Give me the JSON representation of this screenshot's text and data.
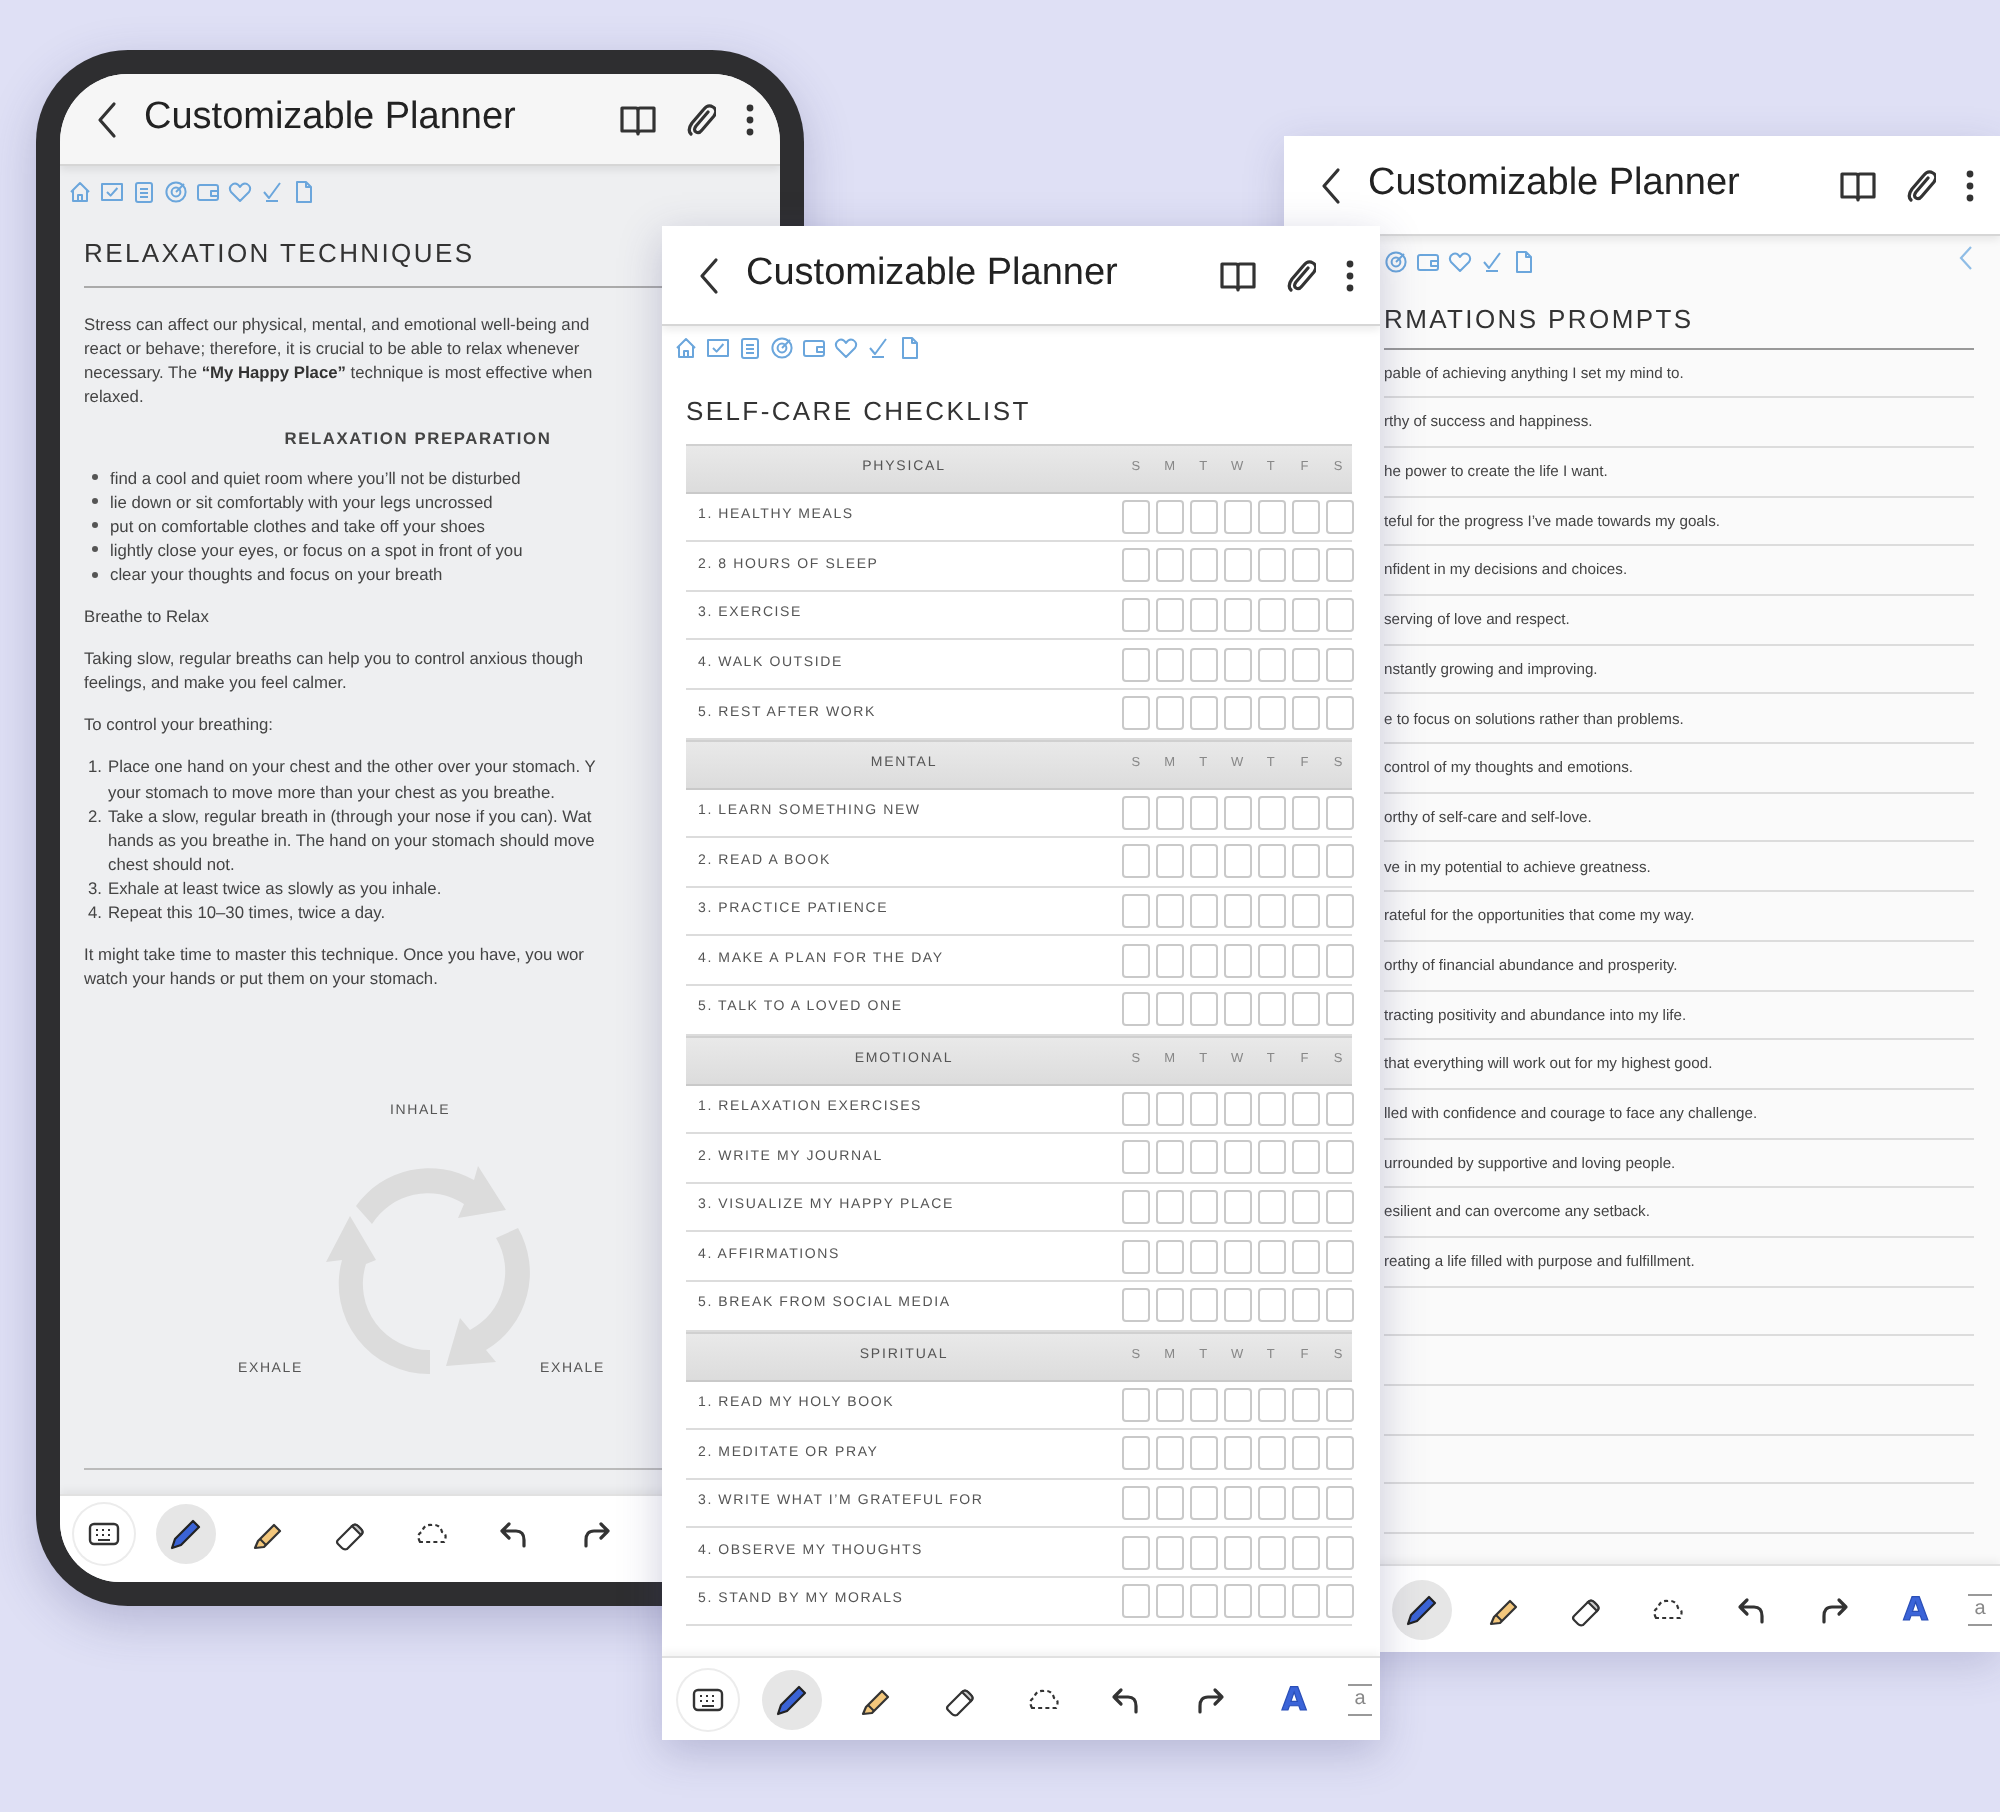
{
  "screens": [
    {
      "kind": "relaxation",
      "title": "Customizable Planner",
      "heading": "RELAXATION TECHNIQUES",
      "intro": [
        "Stress can affect our physical, mental, and emotional well-being and",
        "react or behave; therefore, it is crucial to be able to relax whenever",
        "necessary. The **“My Happy Place”** technique is most effective when",
        "relaxed."
      ],
      "subheading": "RELAXATION PREPARATION",
      "bullets": [
        "find a cool and quiet room where you’ll not be disturbed",
        "lie down or sit comfortably with your legs uncrossed",
        "put on comfortable clothes and take off your shoes",
        "lightly close your eyes, or focus on a spot in front of you",
        "clear your thoughts and focus on your breath"
      ],
      "breathe_title": "Breathe to Relax",
      "breathe_text": [
        "Taking slow, regular breaths can help you to control anxious though",
        "feelings, and make you feel calmer."
      ],
      "control_title": "To control your breathing:",
      "steps": [
        {
          "number": "1.",
          "lines": [
            "Place one hand on your chest and the other over your stomach. Y",
            "your stomach to move more than your chest as you breathe."
          ]
        },
        {
          "number": "2.",
          "lines": [
            "Take a slow, regular breath in (through your nose if you can). Wat",
            "hands as you breathe in. The hand on your stomach should move",
            "chest should not."
          ]
        },
        {
          "number": "3.",
          "lines": [
            "Exhale at least twice as slowly as you inhale."
          ]
        },
        {
          "number": "4.",
          "lines": [
            "Repeat this 10–30 times, twice a day."
          ]
        }
      ],
      "closing": [
        "It might take time to master this technique. Once you have, you wor",
        "watch your hands or put them on your stomach."
      ],
      "diagram": {
        "top_label": "INHALE",
        "left_label": "EXHALE",
        "right_label": "EXHALE"
      },
      "toolbar": [
        {
          "kind": "keyboard",
          "selected": false
        },
        {
          "kind": "pen",
          "selected": true
        },
        {
          "kind": "highlighter",
          "selected": false
        },
        {
          "kind": "eraser",
          "selected": false
        },
        {
          "kind": "lasso",
          "selected": false
        },
        {
          "kind": "undo",
          "selected": false
        },
        {
          "kind": "redo",
          "selected": false
        }
      ]
    },
    {
      "kind": "checklist",
      "title": "Customizable Planner",
      "heading": "SELF-CARE CHECKLIST",
      "sections": [
        {
          "name": "PHYSICAL",
          "days": [
            "S",
            "M",
            "T",
            "W",
            "T",
            "F",
            "S"
          ],
          "rows": [
            {
              "label": "1. HEALTHY MEALS",
              "checks": [
                false,
                false,
                false,
                false,
                false,
                false,
                false
              ]
            },
            {
              "label": "2. 8 HOURS OF SLEEP",
              "checks": [
                false,
                false,
                false,
                false,
                false,
                false,
                false
              ]
            },
            {
              "label": "3. EXERCISE",
              "checks": [
                false,
                false,
                false,
                false,
                false,
                false,
                false
              ]
            },
            {
              "label": "4. WALK OUTSIDE",
              "checks": [
                false,
                false,
                false,
                false,
                false,
                false,
                false
              ]
            },
            {
              "label": "5. REST AFTER WORK",
              "checks": [
                false,
                false,
                false,
                false,
                false,
                false,
                false
              ]
            }
          ]
        },
        {
          "name": "MENTAL",
          "days": [
            "S",
            "M",
            "T",
            "W",
            "T",
            "F",
            "S"
          ],
          "rows": [
            {
              "label": "1. LEARN SOMETHING NEW",
              "checks": [
                false,
                false,
                false,
                false,
                false,
                false,
                false
              ]
            },
            {
              "label": "2. READ A BOOK",
              "checks": [
                false,
                false,
                false,
                false,
                false,
                false,
                false
              ]
            },
            {
              "label": "3. PRACTICE PATIENCE",
              "checks": [
                false,
                false,
                false,
                false,
                false,
                false,
                false
              ]
            },
            {
              "label": "4. MAKE A PLAN FOR THE DAY",
              "checks": [
                false,
                false,
                false,
                false,
                false,
                false,
                false
              ]
            },
            {
              "label": "5. TALK TO A LOVED ONE",
              "checks": [
                false,
                false,
                false,
                false,
                false,
                false,
                false
              ]
            }
          ]
        },
        {
          "name": "EMOTIONAL",
          "days": [
            "S",
            "M",
            "T",
            "W",
            "T",
            "F",
            "S"
          ],
          "rows": [
            {
              "label": "1. RELAXATION EXERCISES",
              "checks": [
                false,
                false,
                false,
                false,
                false,
                false,
                false
              ]
            },
            {
              "label": "2. WRITE MY JOURNAL",
              "checks": [
                false,
                false,
                false,
                false,
                false,
                false,
                false
              ]
            },
            {
              "label": "3. VISUALIZE MY HAPPY PLACE",
              "checks": [
                false,
                false,
                false,
                false,
                false,
                false,
                false
              ]
            },
            {
              "label": "4. AFFIRMATIONS",
              "checks": [
                false,
                false,
                false,
                false,
                false,
                false,
                false
              ]
            },
            {
              "label": "5. BREAK FROM SOCIAL MEDIA",
              "checks": [
                false,
                false,
                false,
                false,
                false,
                false,
                false
              ]
            }
          ]
        },
        {
          "name": "SPIRITUAL",
          "days": [
            "S",
            "M",
            "T",
            "W",
            "T",
            "F",
            "S"
          ],
          "rows": [
            {
              "label": "1. READ MY HOLY BOOK",
              "checks": [
                false,
                false,
                false,
                false,
                false,
                false,
                false
              ]
            },
            {
              "label": "2. MEDITATE OR PRAY",
              "checks": [
                false,
                false,
                false,
                false,
                false,
                false,
                false
              ]
            },
            {
              "label": "3. WRITE WHAT I’M GRATEFUL FOR",
              "checks": [
                false,
                false,
                false,
                false,
                false,
                false,
                false
              ]
            },
            {
              "label": "4. OBSERVE MY THOUGHTS",
              "checks": [
                false,
                false,
                false,
                false,
                false,
                false,
                false
              ]
            },
            {
              "label": "5. STAND BY MY MORALS",
              "checks": [
                false,
                false,
                false,
                false,
                false,
                false,
                false
              ]
            }
          ]
        }
      ],
      "toolbar": [
        {
          "kind": "keyboard",
          "selected": false
        },
        {
          "kind": "pen",
          "selected": true
        },
        {
          "kind": "highlighter",
          "selected": false
        },
        {
          "kind": "eraser",
          "selected": false
        },
        {
          "kind": "lasso",
          "selected": false
        },
        {
          "kind": "undo",
          "selected": false
        },
        {
          "kind": "redo",
          "selected": false
        },
        {
          "kind": "text",
          "label": "A",
          "selected": false
        },
        {
          "kind": "textbox",
          "label": "a",
          "selected": false
        }
      ]
    },
    {
      "kind": "affirmations",
      "title": "Customizable Planner",
      "heading": "RMATIONS PROMPTS",
      "prompts": [
        "pable of achieving anything I set my mind to.",
        "rthy of success and happiness.",
        "he power to create the life I want.",
        "teful for the progress I’ve made towards my goals.",
        "nfident in my decisions and choices.",
        "serving of love and respect.",
        "nstantly growing and improving.",
        "e to focus on solutions rather than problems.",
        "control of my thoughts and emotions.",
        "orthy of self-care and self-love.",
        "ve in my potential to achieve greatness.",
        "rateful for the opportunities that come my way.",
        "orthy of financial abundance and prosperity.",
        "tracting positivity and abundance into my life.",
        "that everything will work out for my highest good.",
        "lled with confidence and courage to face any challenge.",
        "urrounded by supportive and loving people.",
        "esilient and can overcome any setback.",
        "reating a life filled with purpose and fulfillment."
      ],
      "toolbar": [
        {
          "kind": "pen",
          "selected": true
        },
        {
          "kind": "highlighter",
          "selected": false
        },
        {
          "kind": "eraser",
          "selected": false
        },
        {
          "kind": "lasso",
          "selected": false
        },
        {
          "kind": "undo",
          "selected": false
        },
        {
          "kind": "redo",
          "selected": false
        },
        {
          "kind": "text",
          "label": "A",
          "selected": false
        },
        {
          "kind": "textbox",
          "label": "a",
          "selected": false
        }
      ]
    }
  ]
}
